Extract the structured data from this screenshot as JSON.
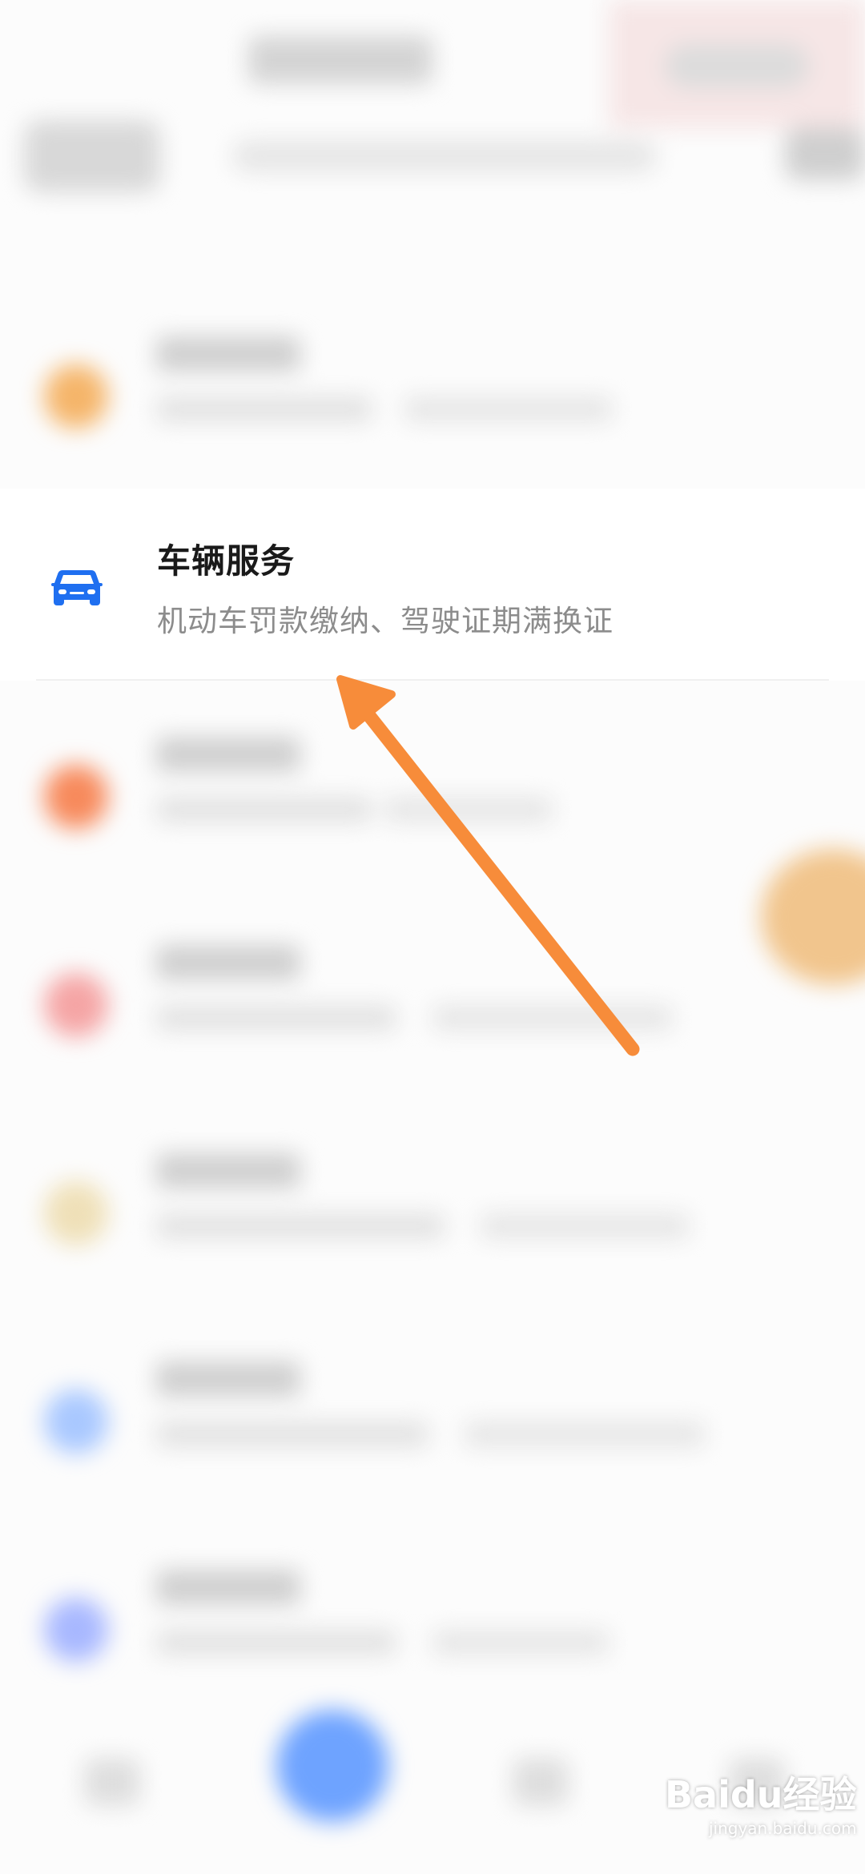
{
  "service_item": {
    "title": "车辆服务",
    "subtitle": "机动车罚款缴纳、驾驶证期满换证",
    "icon": "car-icon",
    "icon_color": "#1f6ff0"
  },
  "blurred_rows": [
    {
      "icon_color": "#f5b56a"
    },
    {
      "icon_color": "#f78a5c"
    },
    {
      "icon_color": "#f5a5a5"
    },
    {
      "icon_color": "#efe0b8"
    },
    {
      "icon_color": "#a9c8ff"
    },
    {
      "icon_color": "#a8b8ff"
    }
  ],
  "annotation": {
    "arrow_color": "#f78c3a"
  },
  "watermark": {
    "brand": "Baidu经验",
    "url": "jingyan.baidu.com"
  }
}
